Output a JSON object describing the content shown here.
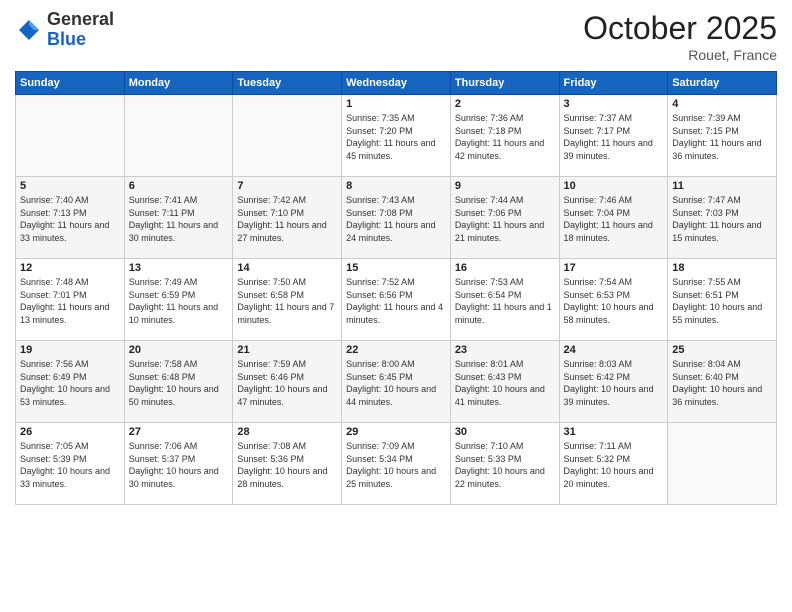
{
  "header": {
    "logo_general": "General",
    "logo_blue": "Blue",
    "month": "October 2025",
    "location": "Rouet, France"
  },
  "days_of_week": [
    "Sunday",
    "Monday",
    "Tuesday",
    "Wednesday",
    "Thursday",
    "Friday",
    "Saturday"
  ],
  "weeks": [
    [
      {
        "day": "",
        "info": ""
      },
      {
        "day": "",
        "info": ""
      },
      {
        "day": "",
        "info": ""
      },
      {
        "day": "1",
        "info": "Sunrise: 7:35 AM\nSunset: 7:20 PM\nDaylight: 11 hours and 45 minutes."
      },
      {
        "day": "2",
        "info": "Sunrise: 7:36 AM\nSunset: 7:18 PM\nDaylight: 11 hours and 42 minutes."
      },
      {
        "day": "3",
        "info": "Sunrise: 7:37 AM\nSunset: 7:17 PM\nDaylight: 11 hours and 39 minutes."
      },
      {
        "day": "4",
        "info": "Sunrise: 7:39 AM\nSunset: 7:15 PM\nDaylight: 11 hours and 36 minutes."
      }
    ],
    [
      {
        "day": "5",
        "info": "Sunrise: 7:40 AM\nSunset: 7:13 PM\nDaylight: 11 hours and 33 minutes."
      },
      {
        "day": "6",
        "info": "Sunrise: 7:41 AM\nSunset: 7:11 PM\nDaylight: 11 hours and 30 minutes."
      },
      {
        "day": "7",
        "info": "Sunrise: 7:42 AM\nSunset: 7:10 PM\nDaylight: 11 hours and 27 minutes."
      },
      {
        "day": "8",
        "info": "Sunrise: 7:43 AM\nSunset: 7:08 PM\nDaylight: 11 hours and 24 minutes."
      },
      {
        "day": "9",
        "info": "Sunrise: 7:44 AM\nSunset: 7:06 PM\nDaylight: 11 hours and 21 minutes."
      },
      {
        "day": "10",
        "info": "Sunrise: 7:46 AM\nSunset: 7:04 PM\nDaylight: 11 hours and 18 minutes."
      },
      {
        "day": "11",
        "info": "Sunrise: 7:47 AM\nSunset: 7:03 PM\nDaylight: 11 hours and 15 minutes."
      }
    ],
    [
      {
        "day": "12",
        "info": "Sunrise: 7:48 AM\nSunset: 7:01 PM\nDaylight: 11 hours and 13 minutes."
      },
      {
        "day": "13",
        "info": "Sunrise: 7:49 AM\nSunset: 6:59 PM\nDaylight: 11 hours and 10 minutes."
      },
      {
        "day": "14",
        "info": "Sunrise: 7:50 AM\nSunset: 6:58 PM\nDaylight: 11 hours and 7 minutes."
      },
      {
        "day": "15",
        "info": "Sunrise: 7:52 AM\nSunset: 6:56 PM\nDaylight: 11 hours and 4 minutes."
      },
      {
        "day": "16",
        "info": "Sunrise: 7:53 AM\nSunset: 6:54 PM\nDaylight: 11 hours and 1 minute."
      },
      {
        "day": "17",
        "info": "Sunrise: 7:54 AM\nSunset: 6:53 PM\nDaylight: 10 hours and 58 minutes."
      },
      {
        "day": "18",
        "info": "Sunrise: 7:55 AM\nSunset: 6:51 PM\nDaylight: 10 hours and 55 minutes."
      }
    ],
    [
      {
        "day": "19",
        "info": "Sunrise: 7:56 AM\nSunset: 6:49 PM\nDaylight: 10 hours and 53 minutes."
      },
      {
        "day": "20",
        "info": "Sunrise: 7:58 AM\nSunset: 6:48 PM\nDaylight: 10 hours and 50 minutes."
      },
      {
        "day": "21",
        "info": "Sunrise: 7:59 AM\nSunset: 6:46 PM\nDaylight: 10 hours and 47 minutes."
      },
      {
        "day": "22",
        "info": "Sunrise: 8:00 AM\nSunset: 6:45 PM\nDaylight: 10 hours and 44 minutes."
      },
      {
        "day": "23",
        "info": "Sunrise: 8:01 AM\nSunset: 6:43 PM\nDaylight: 10 hours and 41 minutes."
      },
      {
        "day": "24",
        "info": "Sunrise: 8:03 AM\nSunset: 6:42 PM\nDaylight: 10 hours and 39 minutes."
      },
      {
        "day": "25",
        "info": "Sunrise: 8:04 AM\nSunset: 6:40 PM\nDaylight: 10 hours and 36 minutes."
      }
    ],
    [
      {
        "day": "26",
        "info": "Sunrise: 7:05 AM\nSunset: 5:39 PM\nDaylight: 10 hours and 33 minutes."
      },
      {
        "day": "27",
        "info": "Sunrise: 7:06 AM\nSunset: 5:37 PM\nDaylight: 10 hours and 30 minutes."
      },
      {
        "day": "28",
        "info": "Sunrise: 7:08 AM\nSunset: 5:36 PM\nDaylight: 10 hours and 28 minutes."
      },
      {
        "day": "29",
        "info": "Sunrise: 7:09 AM\nSunset: 5:34 PM\nDaylight: 10 hours and 25 minutes."
      },
      {
        "day": "30",
        "info": "Sunrise: 7:10 AM\nSunset: 5:33 PM\nDaylight: 10 hours and 22 minutes."
      },
      {
        "day": "31",
        "info": "Sunrise: 7:11 AM\nSunset: 5:32 PM\nDaylight: 10 hours and 20 minutes."
      },
      {
        "day": "",
        "info": ""
      }
    ]
  ]
}
